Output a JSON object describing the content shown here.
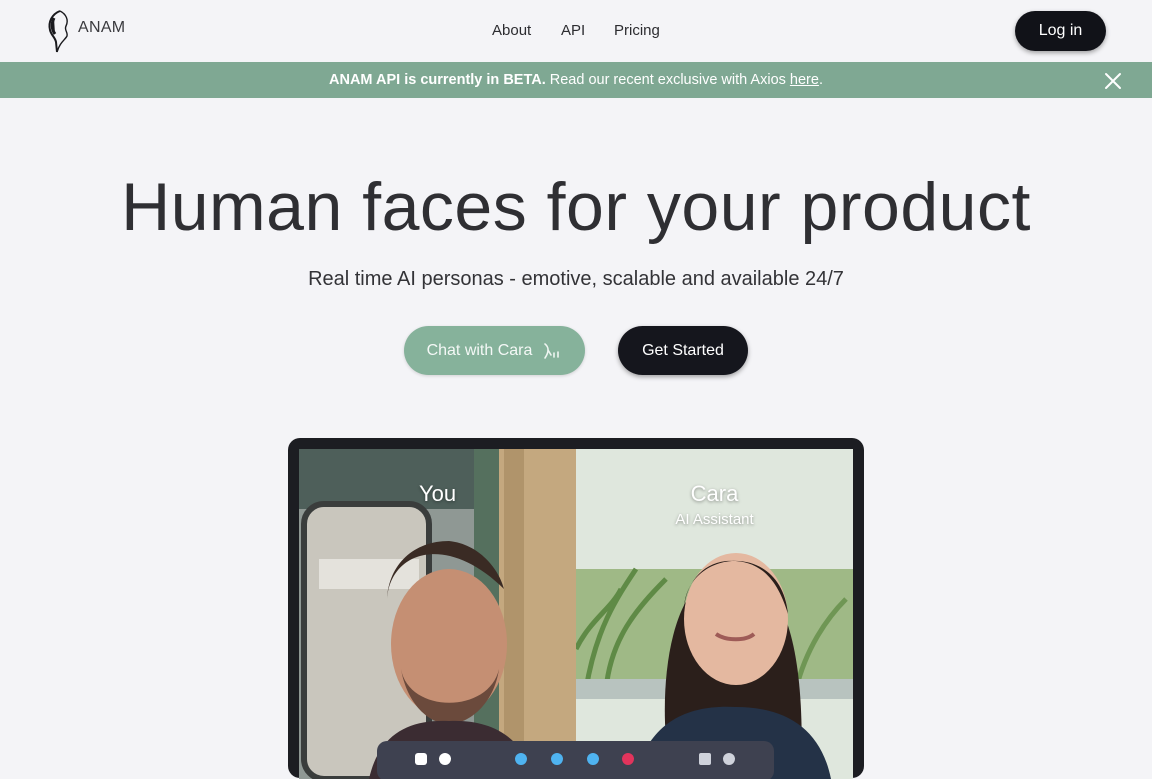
{
  "header": {
    "logo_text": "ANAM",
    "nav": [
      {
        "label": "About"
      },
      {
        "label": "API"
      },
      {
        "label": "Pricing"
      }
    ],
    "login_label": "Log in"
  },
  "banner": {
    "bold": "ANAM API is currently in BETA.",
    "text": "Read our recent exclusive with Axios",
    "link": "here",
    "end": "."
  },
  "hero": {
    "title": "Human faces for your product",
    "subtitle": "Real time AI personas - emotive, scalable and available 24/7",
    "chat_button": "Chat with Cara",
    "start_button": "Get Started"
  },
  "demo": {
    "you_label": "You",
    "cara_label": "Cara",
    "cara_role": "AI Assistant",
    "callbar_icons": [
      "chat-icon",
      "person-icon",
      "mic-icon",
      "camera-icon",
      "add-icon",
      "end-call-icon",
      "expand-icon",
      "settings-icon"
    ]
  },
  "colors": {
    "banner": "#7fa893",
    "chat_button": "#86b29b",
    "dark_button": "#111218",
    "background": "#f4f4f7"
  }
}
